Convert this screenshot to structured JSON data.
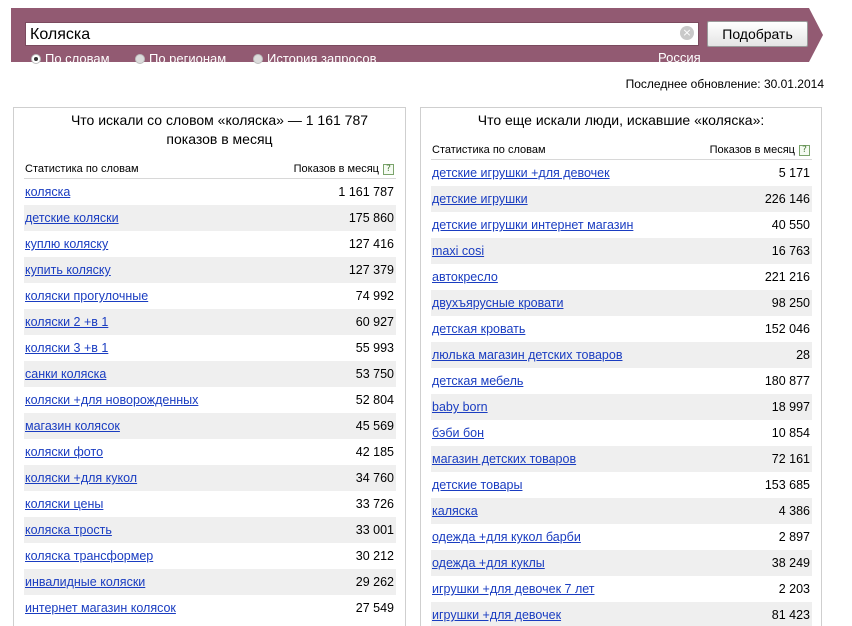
{
  "search": {
    "query": "Коляска",
    "submit_label": "Подобрать",
    "radios": [
      {
        "label": "По словам",
        "selected": true
      },
      {
        "label": "По регионам",
        "selected": false
      },
      {
        "label": "История запросов",
        "selected": false
      }
    ],
    "region_link": "Россия"
  },
  "updated": "Последнее обновление: 30.01.2014",
  "left_panel": {
    "title": "Что искали со словом «коляска» — 1 161 787 показов в месяц",
    "col_phrase": "Статистика по словам",
    "col_count": "Показов в месяц",
    "help": "?",
    "rows": [
      {
        "phrase": "коляска",
        "count": "1 161 787"
      },
      {
        "phrase": "детские коляски",
        "count": "175 860"
      },
      {
        "phrase": "куплю коляску",
        "count": "127 416"
      },
      {
        "phrase": "купить коляску",
        "count": "127 379"
      },
      {
        "phrase": "коляски прогулочные",
        "count": "74 992"
      },
      {
        "phrase": "коляски 2 +в 1",
        "count": "60 927"
      },
      {
        "phrase": "коляски 3 +в 1",
        "count": "55 993"
      },
      {
        "phrase": "санки коляска",
        "count": "53 750"
      },
      {
        "phrase": "коляски +для новорожденных",
        "count": "52 804"
      },
      {
        "phrase": "магазин колясок",
        "count": "45 569"
      },
      {
        "phrase": "коляски фото",
        "count": "42 185"
      },
      {
        "phrase": "коляски +для кукол",
        "count": "34 760"
      },
      {
        "phrase": "коляски цены",
        "count": "33 726"
      },
      {
        "phrase": "коляска трость",
        "count": "33 001"
      },
      {
        "phrase": "коляска трансформер",
        "count": "30 212"
      },
      {
        "phrase": "инвалидные коляски",
        "count": "29 262"
      },
      {
        "phrase": "интернет магазин колясок",
        "count": "27 549"
      }
    ]
  },
  "right_panel": {
    "title": "Что еще искали люди, искавшие «коляска»:",
    "col_phrase": "Статистика по словам",
    "col_count": "Показов в месяц",
    "help": "?",
    "rows": [
      {
        "phrase": "детские игрушки +для девочек",
        "count": "5 171"
      },
      {
        "phrase": "детские игрушки",
        "count": "226 146"
      },
      {
        "phrase": "детские игрушки интернет магазин",
        "count": "40 550"
      },
      {
        "phrase": "maxi cosi",
        "count": "16 763"
      },
      {
        "phrase": "автокресло",
        "count": "221 216"
      },
      {
        "phrase": "двухъярусные кровати",
        "count": "98 250"
      },
      {
        "phrase": "детская кровать",
        "count": "152 046"
      },
      {
        "phrase": "люлька магазин детских товаров",
        "count": "28"
      },
      {
        "phrase": "детская мебель",
        "count": "180 877"
      },
      {
        "phrase": "baby born",
        "count": "18 997"
      },
      {
        "phrase": "бэби бон",
        "count": "10 854"
      },
      {
        "phrase": "магазин детских товаров",
        "count": "72 161"
      },
      {
        "phrase": "детские товары",
        "count": "153 685"
      },
      {
        "phrase": "каляска",
        "count": "4 386"
      },
      {
        "phrase": "одежда +для кукол барби",
        "count": "2 897"
      },
      {
        "phrase": "одежда +для куклы",
        "count": "38 249"
      },
      {
        "phrase": "игрушки +для девочек 7 лет",
        "count": "2 203"
      },
      {
        "phrase": "игрушки +для девочек",
        "count": "81 423"
      }
    ]
  },
  "colors": {
    "topbar": "#925a72",
    "link": "#1a3dc1",
    "row_alt": "#efefef"
  }
}
